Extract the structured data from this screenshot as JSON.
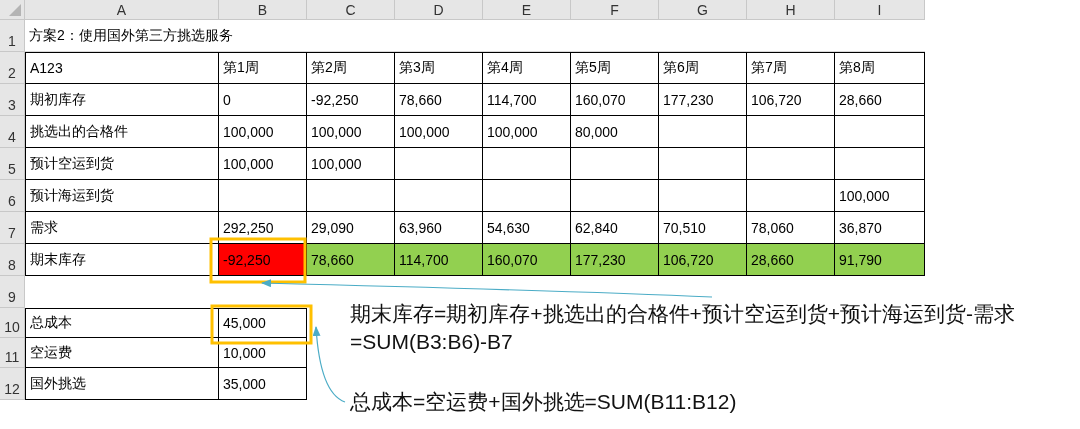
{
  "columns": [
    "A",
    "B",
    "C",
    "D",
    "E",
    "F",
    "G",
    "H",
    "I"
  ],
  "rows": [
    {
      "number": "1",
      "kind": "title",
      "cells": [
        "方案2：使用国外第三方挑选服务"
      ]
    },
    {
      "number": "2",
      "kind": "data",
      "cells": [
        "A123",
        "第1周",
        "第2周",
        "第3周",
        "第4周",
        "第5周",
        "第6周",
        "第7周",
        "第8周"
      ]
    },
    {
      "number": "3",
      "kind": "data",
      "cells": [
        "期初库存",
        "0",
        "-92,250",
        "78,660",
        "114,700",
        "160,070",
        "177,230",
        "106,720",
        "28,660"
      ]
    },
    {
      "number": "4",
      "kind": "data",
      "cells": [
        "挑选出的合格件",
        "100,000",
        "100,000",
        "100,000",
        "100,000",
        "80,000",
        null,
        null,
        null
      ]
    },
    {
      "number": "5",
      "kind": "data",
      "cells": [
        "预计空运到货",
        "100,000",
        "100,000",
        null,
        null,
        null,
        null,
        null,
        null
      ]
    },
    {
      "number": "6",
      "kind": "data",
      "cells": [
        "预计海运到货",
        null,
        null,
        null,
        null,
        null,
        null,
        null,
        "100,000"
      ]
    },
    {
      "number": "7",
      "kind": "data",
      "cells": [
        "需求",
        "292,250",
        "29,090",
        "63,960",
        "54,630",
        "62,840",
        "70,510",
        "78,060",
        "36,870"
      ]
    },
    {
      "number": "8",
      "kind": "data",
      "cells": [
        "期末库存",
        {
          "text": "-92,250",
          "color": "#ff0000"
        },
        {
          "text": "78,660",
          "color": "#92d050"
        },
        {
          "text": "114,700",
          "color": "#92d050"
        },
        {
          "text": "160,070",
          "color": "#92d050"
        },
        {
          "text": "177,230",
          "color": "#92d050"
        },
        {
          "text": "106,720",
          "color": "#92d050"
        },
        {
          "text": "28,660",
          "color": "#92d050"
        },
        {
          "text": "91,790",
          "color": "#92d050"
        }
      ]
    },
    {
      "number": "9",
      "kind": "blank"
    },
    {
      "number": "10",
      "kind": "data",
      "cells": [
        "总成本",
        "45,000"
      ]
    },
    {
      "number": "11",
      "kind": "data",
      "cells": [
        "空运费",
        "10,000"
      ]
    },
    {
      "number": "12",
      "kind": "data",
      "cells": [
        "国外挑选",
        "35,000"
      ]
    }
  ],
  "annotations": [
    {
      "lines": [
        "期末库存=期初库存+挑选出的合格件+预计空运到货+预计海运到货-需求",
        "=SUM(B3:B6)-B7"
      ]
    },
    {
      "lines": [
        "总成本=空运费+国外挑选=SUM(B11:B12)"
      ]
    }
  ]
}
